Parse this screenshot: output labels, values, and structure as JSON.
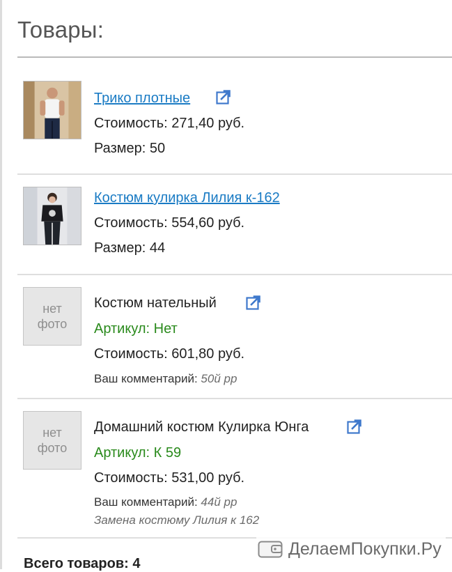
{
  "page": {
    "title": "Товары:",
    "total": "Всего товаров: 4"
  },
  "items": [
    {
      "name": "Трико плотные",
      "price": "Стоимость: 271,40 руб.",
      "size": "Размер: 50",
      "has_link": true
    },
    {
      "name": "Костюм кулирка Лилия к-162",
      "price": "Стоимость: 554,60 руб.",
      "size": "Размер: 44",
      "has_link": true
    },
    {
      "name": "Костюм нательный",
      "sku": "Артикул: Нет",
      "price": "Стоимость: 601,80 руб.",
      "comment_label": "Ваш комментарий:",
      "comment_value": "50й рр",
      "no_photo": "нет\nфото"
    },
    {
      "name": "Домашний костюм Кулирка Юнга",
      "sku": "Артикул: К 59",
      "price": "Стоимость: 531,00 руб.",
      "comment_label": "Ваш комментарий:",
      "comment_value": "44й рр",
      "comment_extra": "Замена костюму Лилия к 162",
      "no_photo": "нет\nфото"
    }
  ],
  "no_photo_lines": [
    "нет",
    "фото"
  ],
  "watermark": "ДелаемПокупки.Ру",
  "colors": {
    "link": "#1a7bc4",
    "sku": "#2a8a1c",
    "ext_icon": "#3f79cc"
  },
  "icons": {
    "external_link": "external-link-icon",
    "wallet": "wallet-icon"
  }
}
